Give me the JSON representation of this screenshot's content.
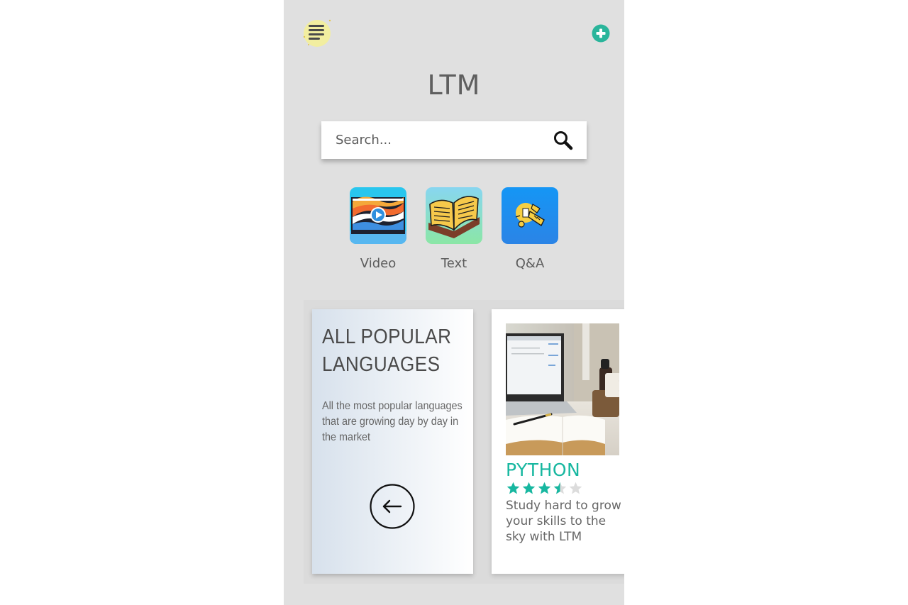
{
  "app": {
    "title": "LTM"
  },
  "search": {
    "placeholder": "Search..."
  },
  "categories": [
    {
      "label": "Video",
      "icon": "video-play-icon"
    },
    {
      "label": "Text",
      "icon": "open-book-icon"
    },
    {
      "label": "Q&A",
      "icon": "qa-lightbulb-icon"
    }
  ],
  "promo": {
    "title": "ALL POPULAR LANGUAGES",
    "description": "All the most popular languages that are growing day by day in the market",
    "action_icon": "arrow-left-icon"
  },
  "course": {
    "name": "PYTHON",
    "rating": 3.5,
    "max_rating": 5,
    "description": "Study hard to grow your skills to the sky with LTM"
  },
  "colors": {
    "accent": "#17b7a0",
    "add_button": "#2ab59b",
    "phone_bg": "#e0e0e0",
    "menu_icon_bg": "#f2eea0"
  }
}
